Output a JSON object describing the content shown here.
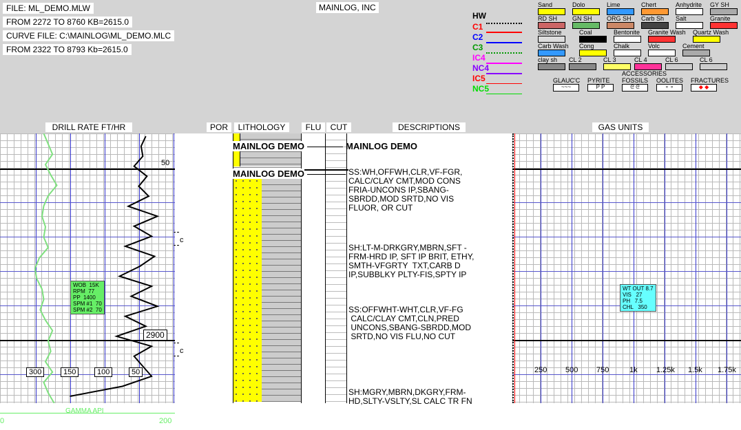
{
  "header": {
    "file": "FILE: ML_DEMO.MLW",
    "range": "FROM 2272  TO 8760  KB=2615.0",
    "curve_file": "CURVE FILE: C:\\MAINLOG\\ML_DEMO.MLC",
    "curve_range": "FROM 2322  TO 8793  Kb=2615.0",
    "company": "MAINLOG, INC"
  },
  "curves": [
    {
      "label": "HW",
      "color": "#000000",
      "style": "dotted"
    },
    {
      "label": "C1",
      "color": "#ff0000",
      "style": "solid"
    },
    {
      "label": "C2",
      "color": "#0000ff",
      "style": "solid"
    },
    {
      "label": "C3",
      "color": "#009900",
      "style": "dotted"
    },
    {
      "label": "IC4",
      "color": "#ff00ff",
      "style": "solid"
    },
    {
      "label": "NC4",
      "color": "#8800ff",
      "style": "solid"
    },
    {
      "label": "IC5",
      "color": "#ff0000",
      "style": "solid"
    },
    {
      "label": "NC5",
      "color": "#00dd00",
      "style": "solid"
    }
  ],
  "lithology_legend": [
    {
      "name": "Sand",
      "color": "#ffff00"
    },
    {
      "name": "Dolo",
      "color": "#ffff00"
    },
    {
      "name": "Lime",
      "color": "#3399ff"
    },
    {
      "name": "Chert",
      "color": "#ff9933"
    },
    {
      "name": "Anhydrite",
      "color": "#ffffff"
    },
    {
      "name": "GY SH",
      "color": "#aaaaaa"
    },
    {
      "name": "RD SH",
      "color": "#cc6666"
    },
    {
      "name": "GN SH",
      "color": "#66bb66"
    },
    {
      "name": "ORG SH",
      "color": "#cc8866"
    },
    {
      "name": "Carb Sh",
      "color": "#444444"
    },
    {
      "name": "Salt",
      "color": "#ffffff"
    },
    {
      "name": "Granite",
      "color": "#ff3333"
    },
    {
      "name": "Siltstone",
      "color": "#dddddd"
    },
    {
      "name": "Coal",
      "color": "#000000"
    },
    {
      "name": "Bentonite",
      "color": "#ffffff"
    },
    {
      "name": "Granite Wash",
      "color": "#ff3333"
    },
    {
      "name": "Quartz Wash",
      "color": "#ffff00"
    },
    {
      "name": "Carb Wash",
      "color": "#3399ff"
    },
    {
      "name": "Cong",
      "color": "#ffff00"
    },
    {
      "name": "Chalk",
      "color": "#ffffff"
    },
    {
      "name": "Volc",
      "color": "#ffffff"
    },
    {
      "name": "Cement",
      "color": "#aaaaaa"
    },
    {
      "name": "clay sh",
      "color": "#888888"
    },
    {
      "name": "CL 2",
      "color": "#888888"
    },
    {
      "name": "CL 3",
      "color": "#ffff66"
    },
    {
      "name": "CL 4",
      "color": "#ff3399"
    },
    {
      "name": "CL 6",
      "color": "#cccccc"
    },
    {
      "name": "CL 6",
      "color": "#cccccc"
    }
  ],
  "accessories": {
    "title": "ACCESSORIES",
    "items": [
      "GLAUC'C",
      "PYRITE",
      "FOSSILS",
      "OOLITES",
      "FRACTURES"
    ],
    "pyrite_symbol": "P P"
  },
  "columns": {
    "drill_rate": "DRILL RATE FT/HR",
    "por": "POR",
    "lithology": "LITHOLOGY",
    "flu": "FLU",
    "cut": "CUT",
    "descriptions": "DESCRIPTIONS",
    "gas": "GAS UNITS"
  },
  "drill_track": {
    "depth_label_50": "50",
    "depth_label_2900": "2900",
    "c_mark": "c",
    "scale": [
      "300",
      "150",
      "100",
      "50"
    ],
    "gamma_label": "GAMMA API",
    "gamma_min": "0",
    "gamma_max": "200",
    "wob_box": "WOB  15K\nRPM  77\nPP  1400\nSPM #1  70\nSPM #2  70"
  },
  "mainlog_tag": "MAINLOG DEMO",
  "descriptions": [
    "SS:WH,OFFWH,CLR,VF-FGR,\nCALC/CLAY CMT,MOD CONS\nFRIA-UNCONS IP,SBANG-\nSBRDD,MOD SRTD,NO VIS\nFLUOR, OR CUT",
    "SH:LT-M-DRKGRY,MBRN,SFT -\nFRM-HRD IP, SFT IP BRIT, ETHY,\nSMTH-VFGRTY  TXT,CARB D\nIP,SUBBLKY PLTY-FIS,SPTY IP",
    "SS:OFFWHT-WHT,CLR,VF-FG\n CALC/CLAY CMT,CLN,PRED\n UNCONS,SBANG-SBRDD,MOD\n SRTD,NO VIS FLU,NO CUT",
    "SH:MGRY,MBRN,DKGRY,FRM-\nHD,SLTY-VSLTY,SL CALC TR FN"
  ],
  "gas_track": {
    "scale": [
      "250",
      "500",
      "750",
      "1k",
      "1.25k",
      "1.5k",
      "1.75k"
    ],
    "mud_box": "WT OUT 8.7\nVIS   27\nPH   7.5\nCHL   350"
  },
  "chart_data": {
    "type": "line",
    "series": [
      {
        "name": "DRILL RATE FT/HR",
        "values": [
          50,
          58,
          55,
          70,
          48,
          62,
          45,
          80,
          30,
          70,
          40,
          85,
          35,
          60,
          95,
          40,
          75,
          30,
          85,
          50,
          100,
          40,
          70,
          55,
          40,
          90,
          180
        ]
      },
      {
        "name": "GAMMA API",
        "values": [
          50,
          55,
          60,
          52,
          58,
          65,
          55,
          50,
          48,
          52,
          50,
          55,
          45,
          40,
          42,
          48,
          50,
          46,
          52,
          60,
          55,
          58,
          52,
          60,
          50,
          55,
          62
        ]
      }
    ]
  }
}
